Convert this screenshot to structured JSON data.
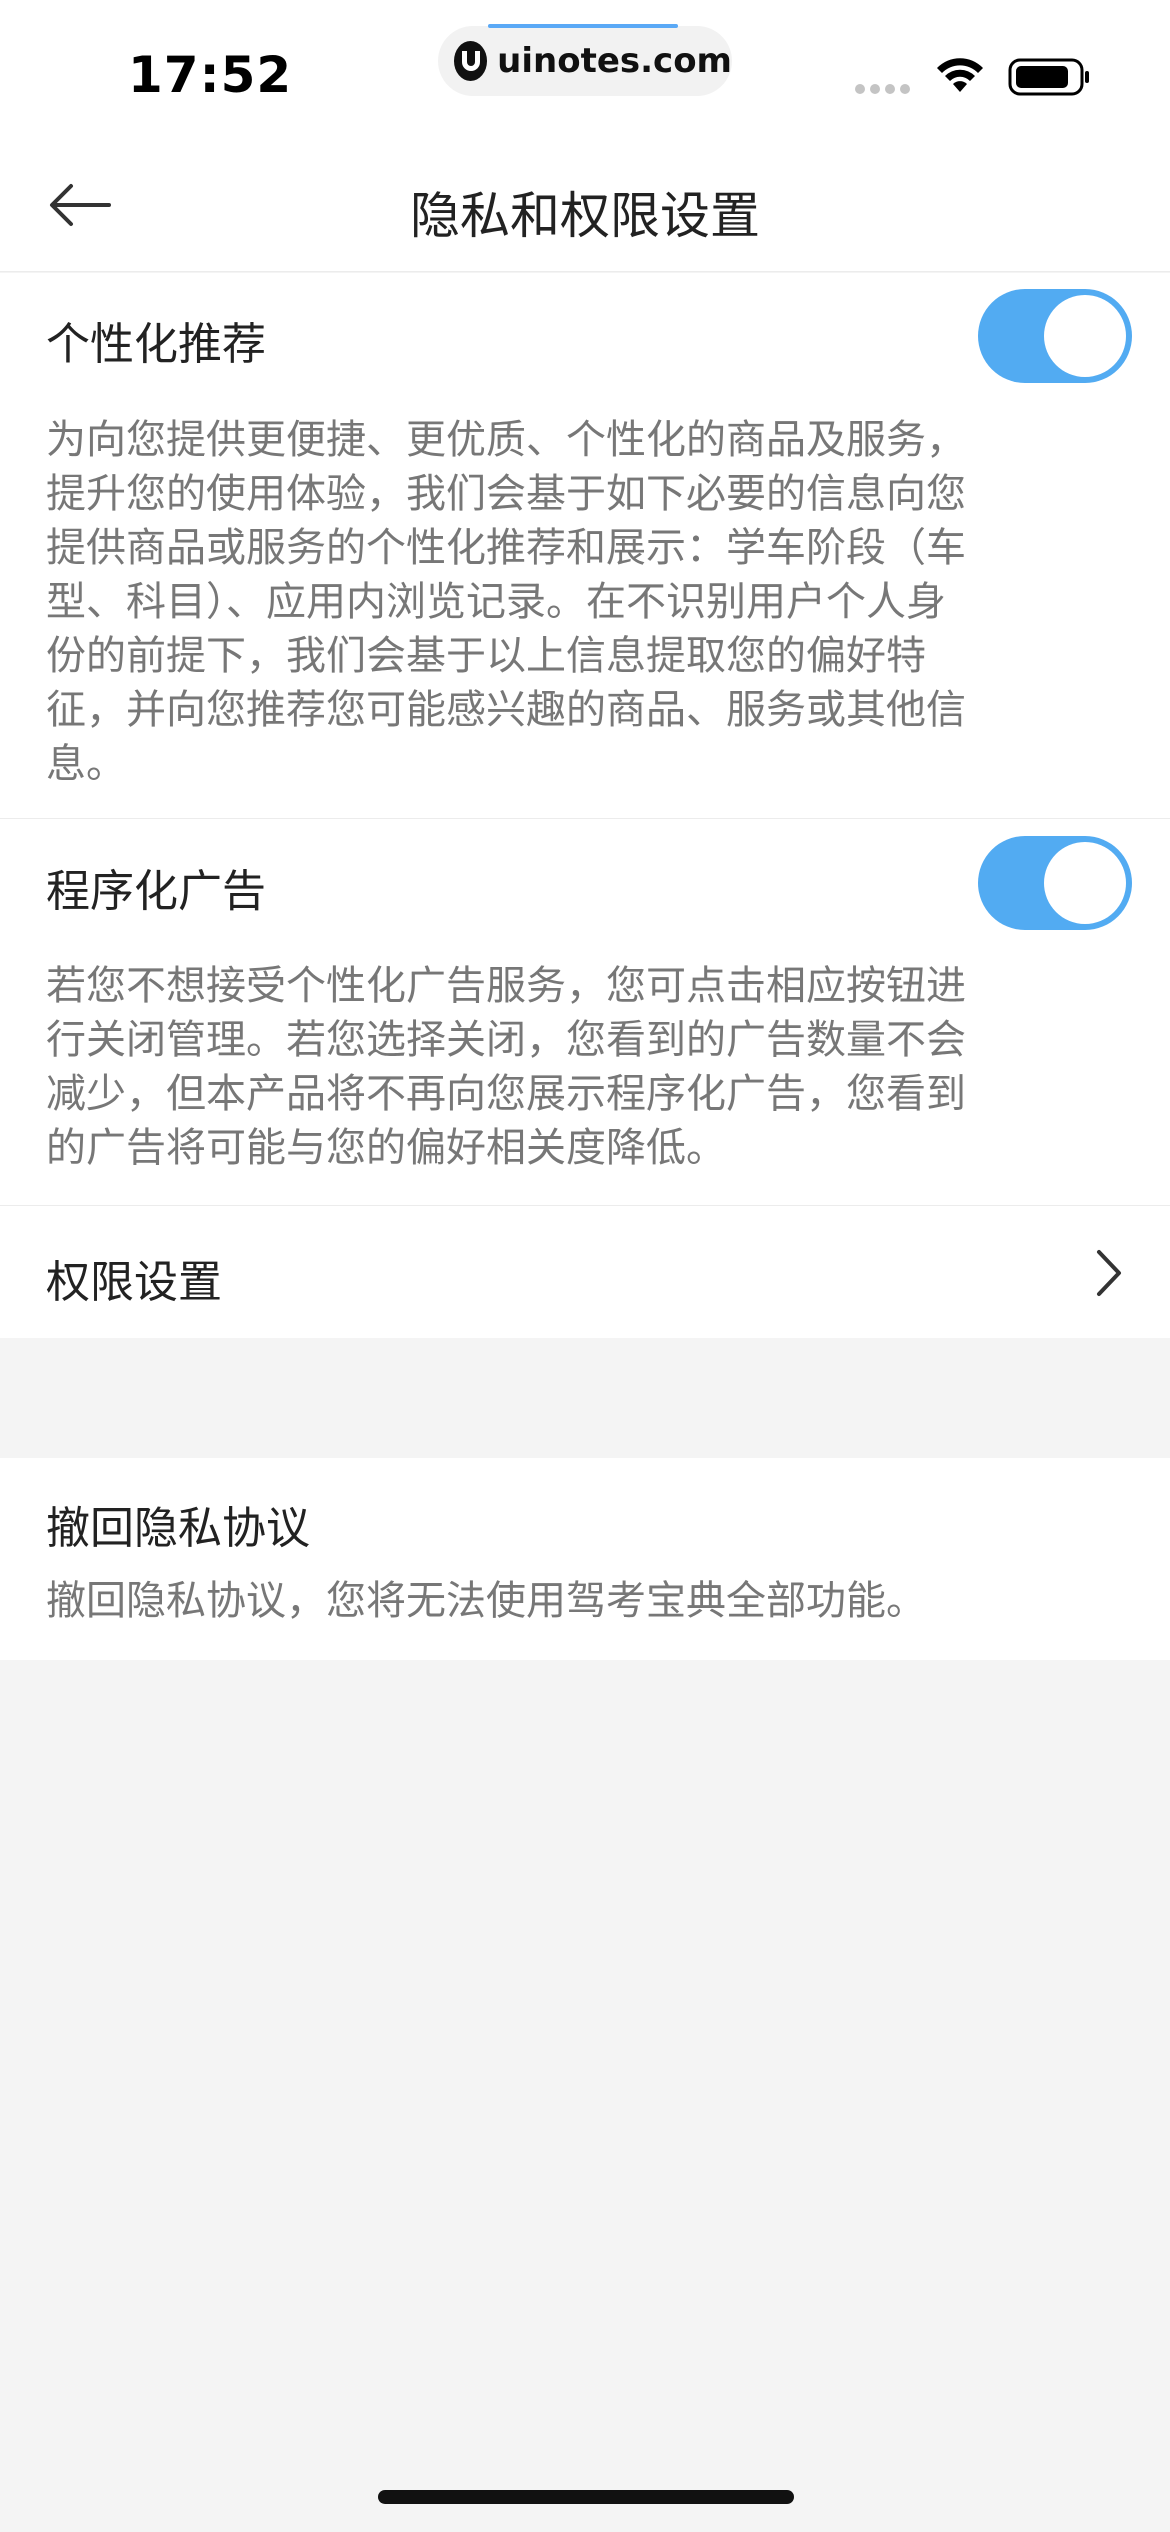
{
  "status_bar": {
    "time": "17:52",
    "url": "uinotes.com",
    "icons": [
      "signal-icon",
      "wifi-icon",
      "battery-icon"
    ]
  },
  "nav": {
    "title": "隐私和权限设置",
    "back_icon": "arrow-left-icon"
  },
  "personalized": {
    "title": "个性化推荐",
    "toggle_on": true,
    "desc_lines": [
      "为向您提供更便捷、更优质、个性化的商品及服务，",
      "提升您的使用体验，我们会基于如下必要的信息向您",
      "提供商品或服务的个性化推荐和展示：学车阶段（车",
      "型、科目）、应用内浏览记录。在不识别用户个人身",
      "份的前提下，我们会基于以上信息提取您的偏好特",
      "征，并向您推荐您可能感兴趣的商品、服务或其他信",
      "息。"
    ]
  },
  "programmatic_ads": {
    "title": "程序化广告",
    "toggle_on": true,
    "desc_lines": [
      "若您不想接受个性化广告服务，您可点击相应按钮进",
      "行关闭管理。若您选择关闭，您看到的广告数量不会",
      "减少，但本产品将不再向您展示程序化广告，您看到",
      "的广告将可能与您的偏好相关度降低。"
    ]
  },
  "permissions": {
    "title": "权限设置",
    "chevron_icon": "chevron-right-icon"
  },
  "revoke": {
    "title": "撤回隐私协议",
    "desc": "撤回隐私协议，您将无法使用驾考宝典全部功能。"
  },
  "colors": {
    "accent": "#52abf2",
    "background": "#f4f4f4",
    "desc_text": "#777777"
  }
}
